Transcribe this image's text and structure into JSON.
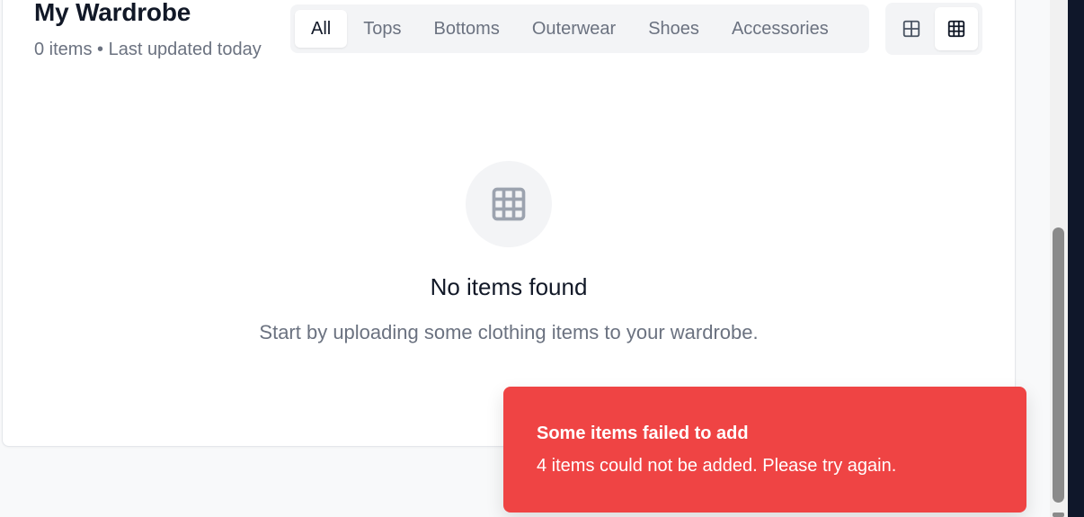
{
  "header": {
    "title": "My Wardrobe",
    "subtitle": "0 items • Last updated today"
  },
  "filters": {
    "tabs": [
      {
        "label": "All",
        "active": true
      },
      {
        "label": "Tops",
        "active": false
      },
      {
        "label": "Bottoms",
        "active": false
      },
      {
        "label": "Outerwear",
        "active": false
      },
      {
        "label": "Shoes",
        "active": false
      },
      {
        "label": "Accessories",
        "active": false
      }
    ]
  },
  "view_toggle": {
    "options": [
      {
        "icon": "grid-2x2-icon",
        "active": false
      },
      {
        "icon": "grid-3x3-icon",
        "active": true
      }
    ]
  },
  "empty_state": {
    "icon": "grid-3x3-icon",
    "title": "No items found",
    "description": "Start by uploading some clothing items to your wardrobe."
  },
  "toast": {
    "title": "Some items failed to add",
    "message": "4 items could not be added. Please try again.",
    "color": "#ef4444"
  },
  "colors": {
    "background": "#f8f9fa",
    "card": "#ffffff",
    "muted_text": "#6b7280",
    "primary_text": "#111827",
    "error": "#ef4444"
  }
}
